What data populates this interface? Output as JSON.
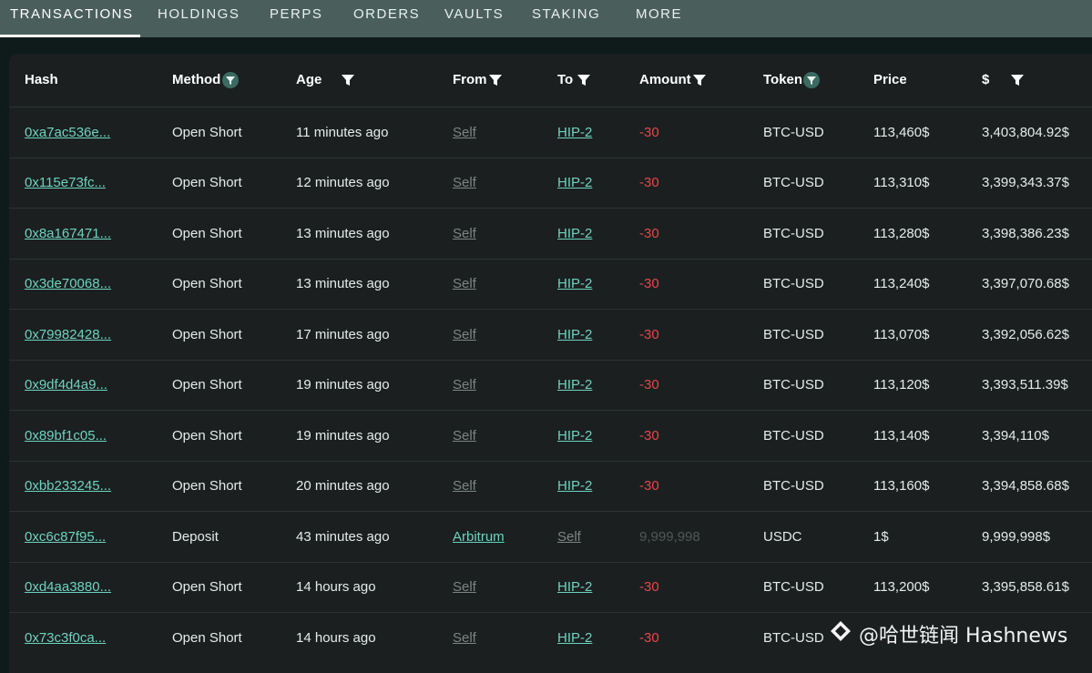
{
  "tabs": [
    "TRANSACTIONS",
    "HOLDINGS",
    "PERPS",
    "ORDERS",
    "VAULTS",
    "STAKING",
    "MORE"
  ],
  "active_tab": "TRANSACTIONS",
  "columns": [
    "Hash",
    "Method",
    "Age",
    "From",
    "To",
    "Amount",
    "Token",
    "Price",
    "$"
  ],
  "rows": [
    {
      "hash": "0xa7ac536e...",
      "method": "Open Short",
      "age": "11 minutes ago",
      "from": "Self",
      "to": "HIP-2",
      "amount": "-30",
      "token": "BTC-USD",
      "price": "113,460$",
      "usd": "3,403,804.92$"
    },
    {
      "hash": "0x115e73fc...",
      "method": "Open Short",
      "age": "12 minutes ago",
      "from": "Self",
      "to": "HIP-2",
      "amount": "-30",
      "token": "BTC-USD",
      "price": "113,310$",
      "usd": "3,399,343.37$"
    },
    {
      "hash": "0x8a167471...",
      "method": "Open Short",
      "age": "13 minutes ago",
      "from": "Self",
      "to": "HIP-2",
      "amount": "-30",
      "token": "BTC-USD",
      "price": "113,280$",
      "usd": "3,398,386.23$"
    },
    {
      "hash": "0x3de70068...",
      "method": "Open Short",
      "age": "13 minutes ago",
      "from": "Self",
      "to": "HIP-2",
      "amount": "-30",
      "token": "BTC-USD",
      "price": "113,240$",
      "usd": "3,397,070.68$"
    },
    {
      "hash": "0x79982428...",
      "method": "Open Short",
      "age": "17 minutes ago",
      "from": "Self",
      "to": "HIP-2",
      "amount": "-30",
      "token": "BTC-USD",
      "price": "113,070$",
      "usd": "3,392,056.62$"
    },
    {
      "hash": "0x9df4d4a9...",
      "method": "Open Short",
      "age": "19 minutes ago",
      "from": "Self",
      "to": "HIP-2",
      "amount": "-30",
      "token": "BTC-USD",
      "price": "113,120$",
      "usd": "3,393,511.39$"
    },
    {
      "hash": "0x89bf1c05...",
      "method": "Open Short",
      "age": "19 minutes ago",
      "from": "Self",
      "to": "HIP-2",
      "amount": "-30",
      "token": "BTC-USD",
      "price": "113,140$",
      "usd": "3,394,110$"
    },
    {
      "hash": "0xbb233245...",
      "method": "Open Short",
      "age": "20 minutes ago",
      "from": "Self",
      "to": "HIP-2",
      "amount": "-30",
      "token": "BTC-USD",
      "price": "113,160$",
      "usd": "3,394,858.68$"
    },
    {
      "hash": "0xc6c87f95...",
      "method": "Deposit",
      "age": "43 minutes ago",
      "from": "Arbitrum",
      "to": "Self",
      "amount": "9,999,998",
      "token": "USDC",
      "price": "1$",
      "usd": "9,999,998$"
    },
    {
      "hash": "0xd4aa3880...",
      "method": "Open Short",
      "age": "14 hours ago",
      "from": "Self",
      "to": "HIP-2",
      "amount": "-30",
      "token": "BTC-USD",
      "price": "113,200$",
      "usd": "3,395,858.61$"
    },
    {
      "hash": "0x73c3f0ca...",
      "method": "Open Short",
      "age": "14 hours ago",
      "from": "Self",
      "to": "HIP-2",
      "amount": "-30",
      "token": "BTC-USD",
      "price": "",
      "usd": ""
    }
  ],
  "watermark": "@哈世链闻 Hashnews",
  "colors": {
    "accent": "#6ed3be",
    "negative": "#e24a4a",
    "tab_bar": "#4a5f5c",
    "panel": "#1b1f20"
  }
}
